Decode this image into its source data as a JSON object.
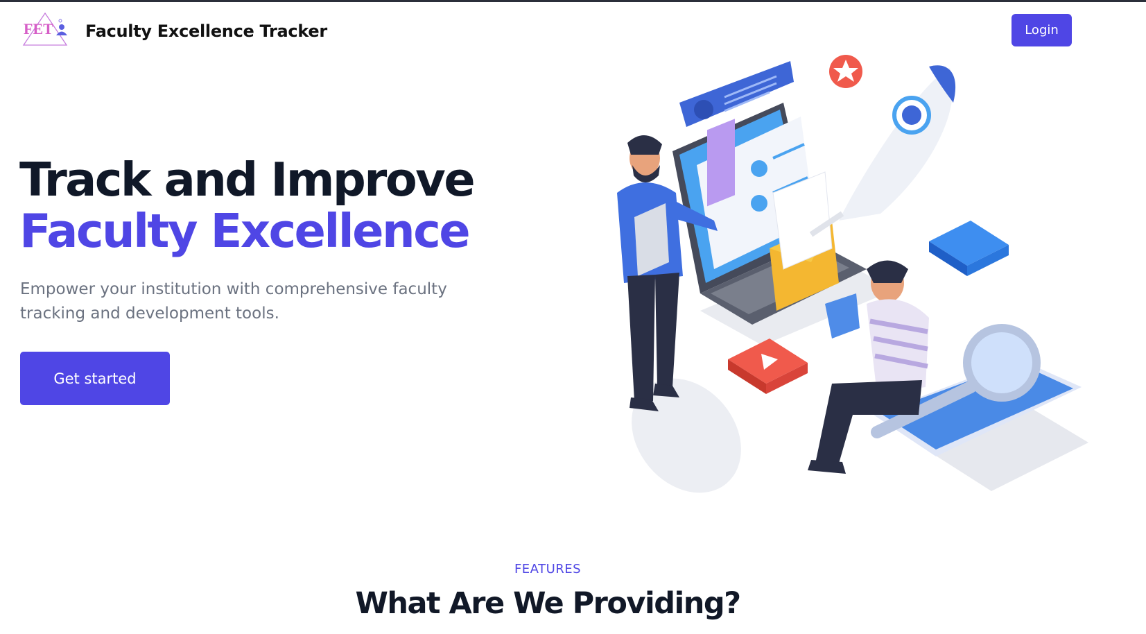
{
  "navbar": {
    "logo_text": "FET",
    "brand": "Faculty Excellence Tracker",
    "login_label": "Login"
  },
  "hero": {
    "title_line1": "Track and Improve",
    "title_line2": "Faculty Excellence",
    "subtitle": "Empower your institution with comprehensive faculty tracking and development tools.",
    "cta_label": "Get started",
    "illustration": "isometric-people-laptop-rocket-illustration"
  },
  "features": {
    "eyebrow": "FEATURES",
    "heading": "What Are We Providing?"
  },
  "colors": {
    "accent": "#4f46e5",
    "heading": "#101828",
    "body_text": "#6b7280"
  }
}
